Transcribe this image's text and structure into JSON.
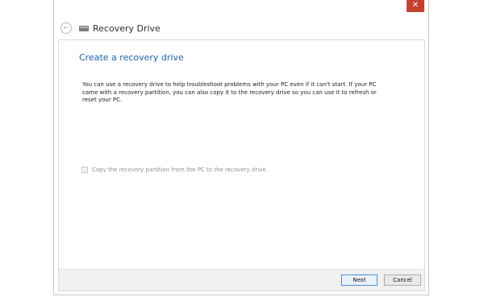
{
  "window": {
    "title": "Recovery Drive",
    "close_glyph": "✕"
  },
  "icons": {
    "back": "back-arrow-icon",
    "drive": "drive-icon",
    "close": "close-icon"
  },
  "back_glyph": "←",
  "content": {
    "heading": "Create a recovery drive",
    "description": "You can use a recovery drive to help troubleshoot problems with your PC even if it can't start. If your PC came with a recovery partition, you can also copy it to the recovery drive so you can use it to refresh or reset your PC.",
    "checkbox": {
      "label": "Copy the recovery partition from the PC to the recovery drive.",
      "checked": false,
      "enabled": false
    }
  },
  "footer": {
    "next_label": "Next",
    "cancel_label": "Cancel"
  },
  "colors": {
    "heading": "#1c5fad",
    "close_button": "#c7402e",
    "footer_bg": "#f0f0f0"
  }
}
